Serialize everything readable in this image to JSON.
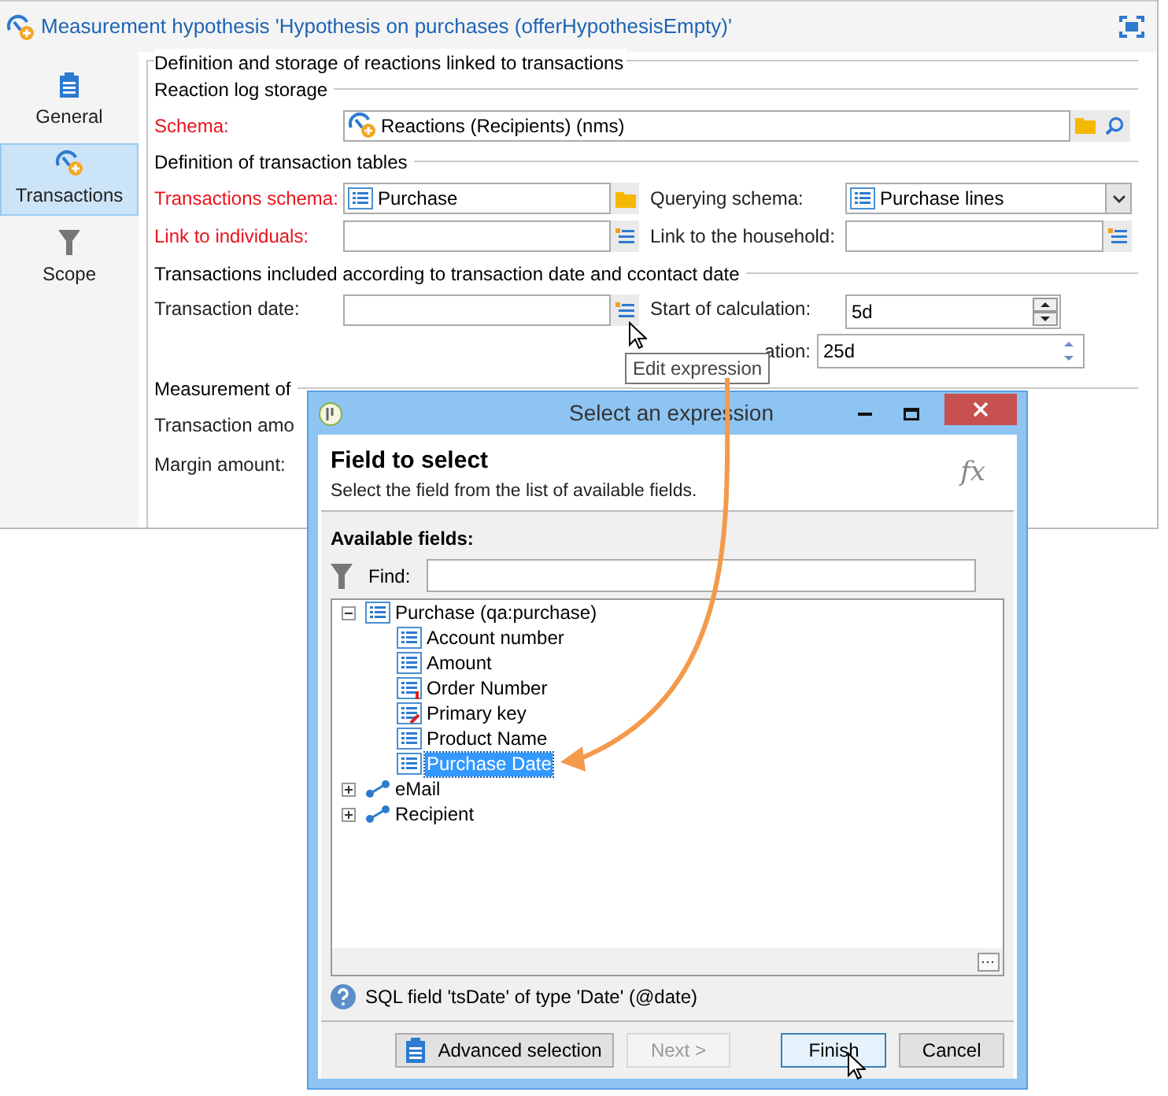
{
  "window": {
    "title": "Measurement hypothesis 'Hypothesis on purchases (offerHypothesisEmpty)'"
  },
  "sidebar": {
    "items": [
      {
        "label": "General",
        "kind": "clipboard",
        "selected": false
      },
      {
        "label": "Transactions",
        "kind": "gauge",
        "selected": true
      },
      {
        "label": "Scope",
        "kind": "filter",
        "selected": false
      }
    ]
  },
  "form": {
    "heading": "Definition and storage of reactions linked to transactions",
    "reaction_log": {
      "title": "Reaction log storage",
      "schema": {
        "label": "Schema:",
        "required": true,
        "value": "Reactions (Recipients) (nms)"
      }
    },
    "transaction_tables": {
      "title": "Definition of transaction tables",
      "transactions_schema": {
        "label": "Transactions schema:",
        "required": true,
        "value": "Purchase"
      },
      "querying_schema": {
        "label": "Querying schema:",
        "required": false,
        "value": "Purchase lines"
      },
      "link_to_individuals": {
        "label": "Link to individuals:",
        "required": true
      },
      "link_to_household": {
        "label": "Link to the household:",
        "required": false
      }
    },
    "transactions_included": {
      "title": "Transactions included according to transaction date and ccontact date",
      "transaction_date": {
        "label": "Transaction date:"
      },
      "start_of_calculation": {
        "label": "Start of calculation:",
        "value": "5d"
      },
      "end_of_calculation": {
        "label": "ation:",
        "value": "25d"
      }
    },
    "measurement": {
      "title": "Measurement of",
      "transaction_amount": {
        "label": "Transaction amo"
      },
      "margin_amount": {
        "label": "Margin amount:"
      }
    }
  },
  "tooltip": "Edit expression",
  "dialog": {
    "title": "Select an expression",
    "heading": "Field to select",
    "subtitle": "Select the field from the list of available fields.",
    "fx": "fx",
    "available_label": "Available fields:",
    "find_label": "Find:",
    "tree": [
      {
        "label": "Purchase (qa:purchase)",
        "kind": "table",
        "expanded": true,
        "selected": false,
        "children": [
          {
            "label": "Account number",
            "kind": "field",
            "selected": false
          },
          {
            "label": "Amount",
            "kind": "field",
            "selected": false
          },
          {
            "label": "Order Number",
            "kind": "mandatory",
            "selected": false
          },
          {
            "label": "Primary key",
            "kind": "key",
            "selected": false
          },
          {
            "label": "Product Name",
            "kind": "field",
            "selected": false
          },
          {
            "label": "Purchase Date",
            "kind": "field",
            "selected": true
          }
        ]
      },
      {
        "label": "eMail",
        "kind": "link",
        "expanded": false,
        "selected": false
      },
      {
        "label": "Recipient",
        "kind": "link",
        "expanded": false,
        "selected": false
      }
    ],
    "help": "SQL field 'tsDate' of type 'Date' (@date)",
    "buttons": [
      {
        "label": "Advanced selection",
        "kind": "advanced",
        "disabled": false,
        "focused": false
      },
      {
        "label": "Next >",
        "kind": "plain",
        "disabled": true,
        "focused": false
      },
      {
        "label": "Finish",
        "kind": "plain",
        "disabled": false,
        "focused": true
      },
      {
        "label": "Cancel",
        "kind": "plain",
        "disabled": false,
        "focused": false
      }
    ]
  }
}
